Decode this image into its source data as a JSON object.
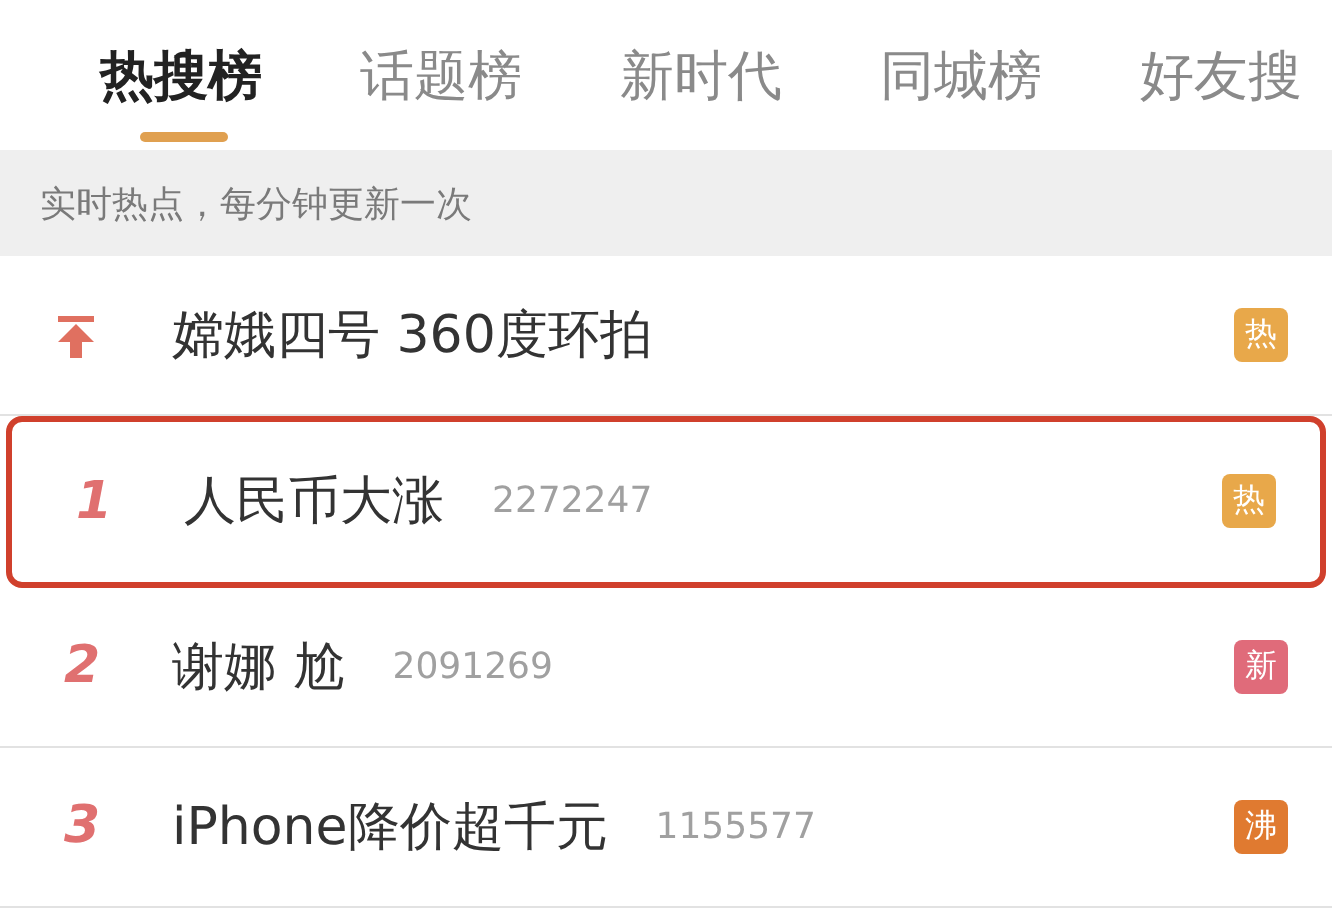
{
  "tabs": [
    {
      "label": "热搜榜",
      "selected": true
    },
    {
      "label": "话题榜",
      "selected": false
    },
    {
      "label": "新时代",
      "selected": false
    },
    {
      "label": "同城榜",
      "selected": false
    },
    {
      "label": "好友搜",
      "selected": false
    }
  ],
  "notice": "实时热点，每分钟更新一次",
  "rows": [
    {
      "kind": "pinned",
      "title": "嫦娥四号 360度环拍",
      "badge": "热",
      "color": "#e8a84a",
      "highlighted": false
    },
    {
      "kind": "ranked",
      "rank": "1",
      "title": "人民币大涨",
      "count": "2272247",
      "badge": "热",
      "color": "#e8a84a",
      "highlighted": true
    },
    {
      "kind": "ranked",
      "rank": "2",
      "title": "谢娜 尬",
      "count": "2091269",
      "badge": "新",
      "color": "#e06b7a",
      "highlighted": false
    },
    {
      "kind": "ranked",
      "rank": "3",
      "title": "iPhone降价超千元",
      "count": "1155577",
      "badge": "沸",
      "color": "#e07a30",
      "highlighted": false
    }
  ]
}
